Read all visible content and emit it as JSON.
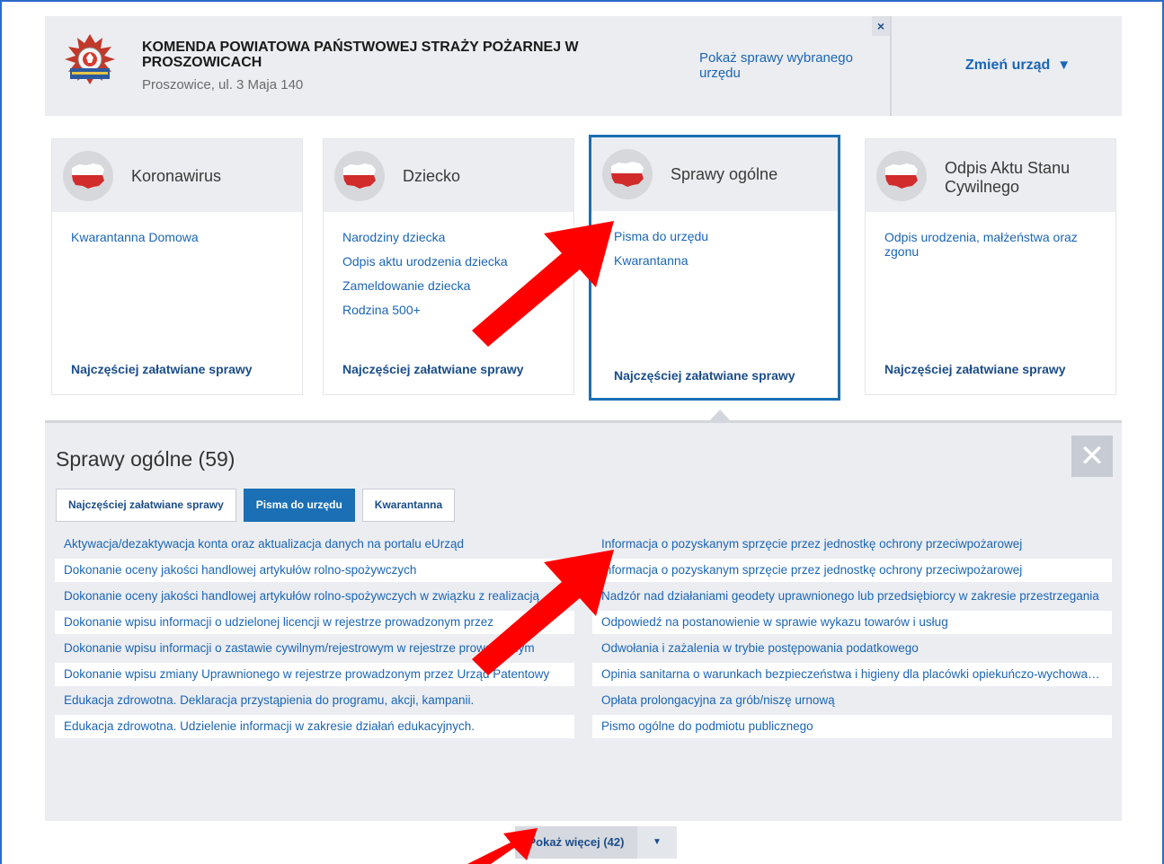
{
  "header": {
    "office_name": "KOMENDA POWIATOWA PAŃSTWOWEJ STRAŻY POŻARNEJ W PROSZOWICACH",
    "office_address": "Proszowice, ul. 3 Maja 140",
    "show_cases_link": "Pokaż sprawy wybranego urzędu",
    "close_label": "×",
    "change_office_label": "Zmień urząd",
    "change_office_arrow": "▼"
  },
  "categories": [
    {
      "title": "Koronawirus",
      "icon": "poland-map-icon",
      "links": [
        "Kwarantanna Domowa"
      ],
      "footer": "Najczęściej załatwiane sprawy"
    },
    {
      "title": "Dziecko",
      "icon": "poland-map-icon",
      "links": [
        "Narodziny dziecka",
        "Odpis aktu urodzenia dziecka",
        "Zameldowanie dziecka",
        "Rodzina 500+"
      ],
      "footer": "Najczęściej załatwiane sprawy"
    },
    {
      "title": "Sprawy ogólne",
      "icon": "poland-map-icon",
      "links": [
        "Pisma do urzędu",
        "Kwarantanna"
      ],
      "footer": "Najczęściej załatwiane sprawy"
    },
    {
      "title": "Odpis Aktu Stanu Cywilnego",
      "icon": "poland-map-icon",
      "links": [
        "Odpis urodzenia, małżeństwa oraz zgonu"
      ],
      "footer": "Najczęściej załatwiane sprawy"
    }
  ],
  "panel": {
    "title": "Sprawy ogólne (59)",
    "close_label": "✕",
    "tabs": [
      "Najczęściej załatwiane sprawy",
      "Pisma do urzędu",
      "Kwarantanna"
    ],
    "active_tab": "Pisma do urzędu",
    "left_items": [
      "Aktywacja/dezaktywacja konta oraz aktualizacja danych na portalu eUrząd",
      "Dokonanie oceny jakości handlowej artykułów rolno-spożywczych",
      "Dokonanie oceny jakości handlowej artykułów rolno-spożywczych w związku z realizacją",
      "Dokonanie wpisu informacji o udzielonej licencji w rejestrze prowadzonym przez",
      "Dokonanie wpisu informacji o zastawie cywilnym/rejestrowym w rejestrze prowadzonym",
      "Dokonanie wpisu zmiany Uprawnionego w rejestrze prowadzonym przez Urząd Patentowy",
      "Edukacja zdrowotna. Deklaracja przystąpienia do programu, akcji, kampanii.",
      "Edukacja zdrowotna. Udzielenie informacji w zakresie działań edukacyjnych."
    ],
    "right_items": [
      "Informacja o pozyskanym sprzęcie przez jednostkę ochrony przeciwpożarowej",
      "Informacja o pozyskanym sprzęcie przez jednostkę ochrony przeciwpożarowej",
      "Nadzór nad działaniami geodety uprawnionego lub przedsiębiorcy w zakresie przestrzegania",
      "Odpowiedź na postanowienie w sprawie wykazu towarów i usług",
      "Odwołania i zażalenia w trybie postępowania podatkowego",
      "Opinia sanitarna o warunkach bezpieczeństwa i higieny dla placówki opiekuńczo-wychowawczej",
      "Opłata prolongacyjna za grób/niszę urnową",
      "Pismo ogólne do podmiotu publicznego"
    ],
    "show_more_label": "Pokaż więcej (42)",
    "show_more_arrow": "▼"
  },
  "colors": {
    "link": "#1b65b6",
    "active_border": "#1a6fb5",
    "annotation_arrow": "#ff0000",
    "panel_bg": "#ebedf1"
  }
}
